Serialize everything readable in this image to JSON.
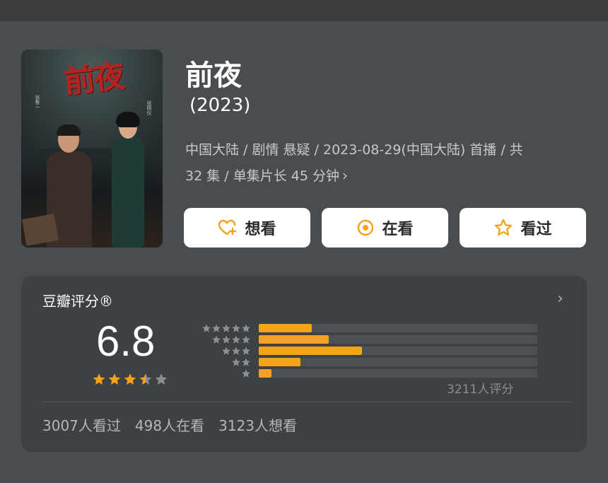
{
  "movie": {
    "title": "前夜",
    "year": "(2023)",
    "meta_line1": "中国大陆 / 剧情 悬疑 / 2023-08-29(中国大陆) 首播 / 共",
    "meta_line2": "32 集 / 单集片长 45 分钟",
    "meta_more": "›"
  },
  "poster": {
    "title": "前夜",
    "cast_left": "张鲁一",
    "cast_right": "张婧仪"
  },
  "actions": {
    "want": "想看",
    "watching": "在看",
    "watched": "看过"
  },
  "rating": {
    "label": "豆瓣评分®",
    "score": "6.8",
    "stars_value": 3.5,
    "stars_max": 5,
    "count_text": "3211人评分",
    "distribution": [
      {
        "stars": 5,
        "fraction": 0.19
      },
      {
        "stars": 4,
        "fraction": 0.25
      },
      {
        "stars": 3,
        "fraction": 0.37
      },
      {
        "stars": 2,
        "fraction": 0.15
      },
      {
        "stars": 1,
        "fraction": 0.045
      }
    ],
    "more": "›"
  },
  "stats": {
    "watched": "3007人看过",
    "watching": "498人在看",
    "want": "3123人想看"
  },
  "colors": {
    "accent": "#f6a21a",
    "background": "#4a4d4f",
    "card": "#3e4143"
  },
  "icons": {
    "want": "heart-plus-icon",
    "watching": "target-circle-icon",
    "watched": "star-outline-icon"
  }
}
